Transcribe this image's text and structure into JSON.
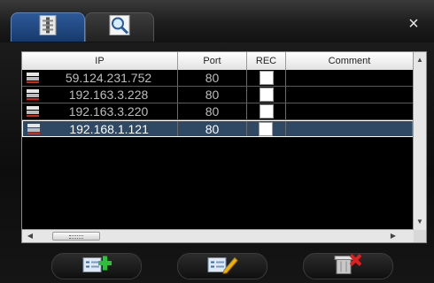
{
  "toolbar": {
    "tabs": [
      {
        "icon": "device-list-icon"
      },
      {
        "icon": "search-icon"
      }
    ],
    "close_label": "×"
  },
  "table": {
    "columns": [
      "IP",
      "Port",
      "REC",
      "Comment"
    ],
    "rows": [
      {
        "ip": "59.124.231.752",
        "port": "80",
        "rec": false,
        "comment": "",
        "selected": false
      },
      {
        "ip": "192.163.3.228",
        "port": "80",
        "rec": false,
        "comment": "",
        "selected": false
      },
      {
        "ip": "192.163.3.220",
        "port": "80",
        "rec": false,
        "comment": "",
        "selected": false
      },
      {
        "ip": "192.168.1.121",
        "port": "80",
        "rec": false,
        "comment": "",
        "selected": true
      }
    ]
  },
  "buttons": [
    {
      "icon": "add-device-icon"
    },
    {
      "icon": "edit-device-icon"
    },
    {
      "icon": "delete-device-icon"
    }
  ],
  "colors": {
    "selection": "#2f4863",
    "active_tab": "#2d5a98",
    "add_accent": "#2fbf3a",
    "edit_accent": "#f2b400",
    "delete_accent": "#e02020"
  }
}
